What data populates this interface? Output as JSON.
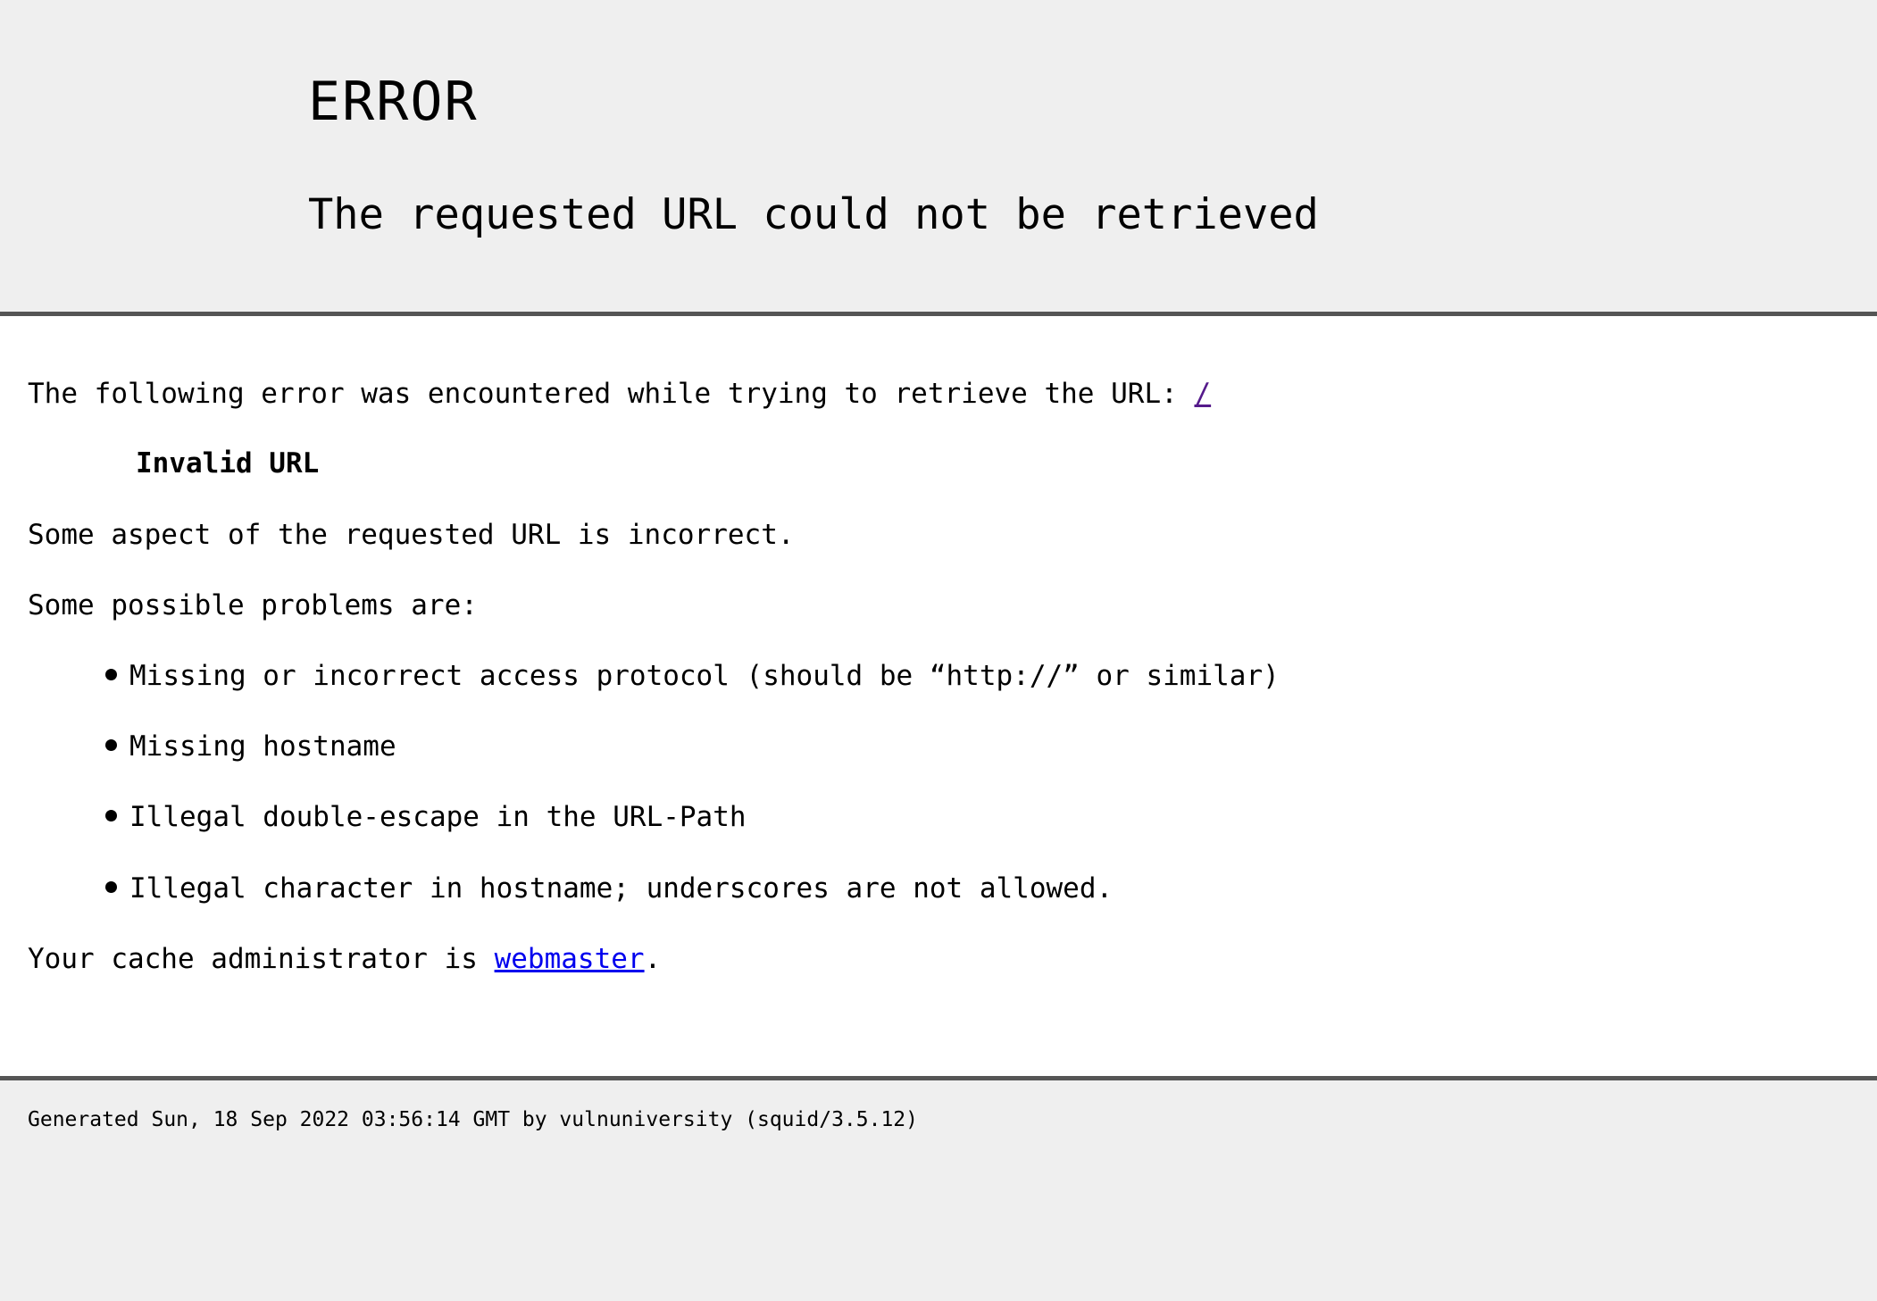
{
  "header": {
    "brand": "ERROR",
    "title": "The requested URL could not be retrieved"
  },
  "content": {
    "intro_text": "The following error was encountered while trying to retrieve the URL: ",
    "url_link": "/",
    "error_code": "Invalid URL",
    "description": "Some aspect of the requested URL is incorrect.",
    "problems_heading": "Some possible problems are:",
    "problems": [
      "Missing or incorrect access protocol (should be “http://” or similar)",
      "Missing hostname",
      "Illegal double-escape in the URL-Path",
      "Illegal character in hostname; underscores are not allowed."
    ],
    "admin_prefix": "Your cache administrator is ",
    "admin_link": "webmaster",
    "admin_suffix": "."
  },
  "footer": {
    "generated": "Generated Sun, 18 Sep 2022 03:56:14 GMT by vulnuniversity (squid/3.5.12)"
  },
  "colors": {
    "background": "#efefef",
    "content_background": "#ffffff",
    "rule": "#555555",
    "visited_link": "#551a8b",
    "link": "#0000ee"
  }
}
